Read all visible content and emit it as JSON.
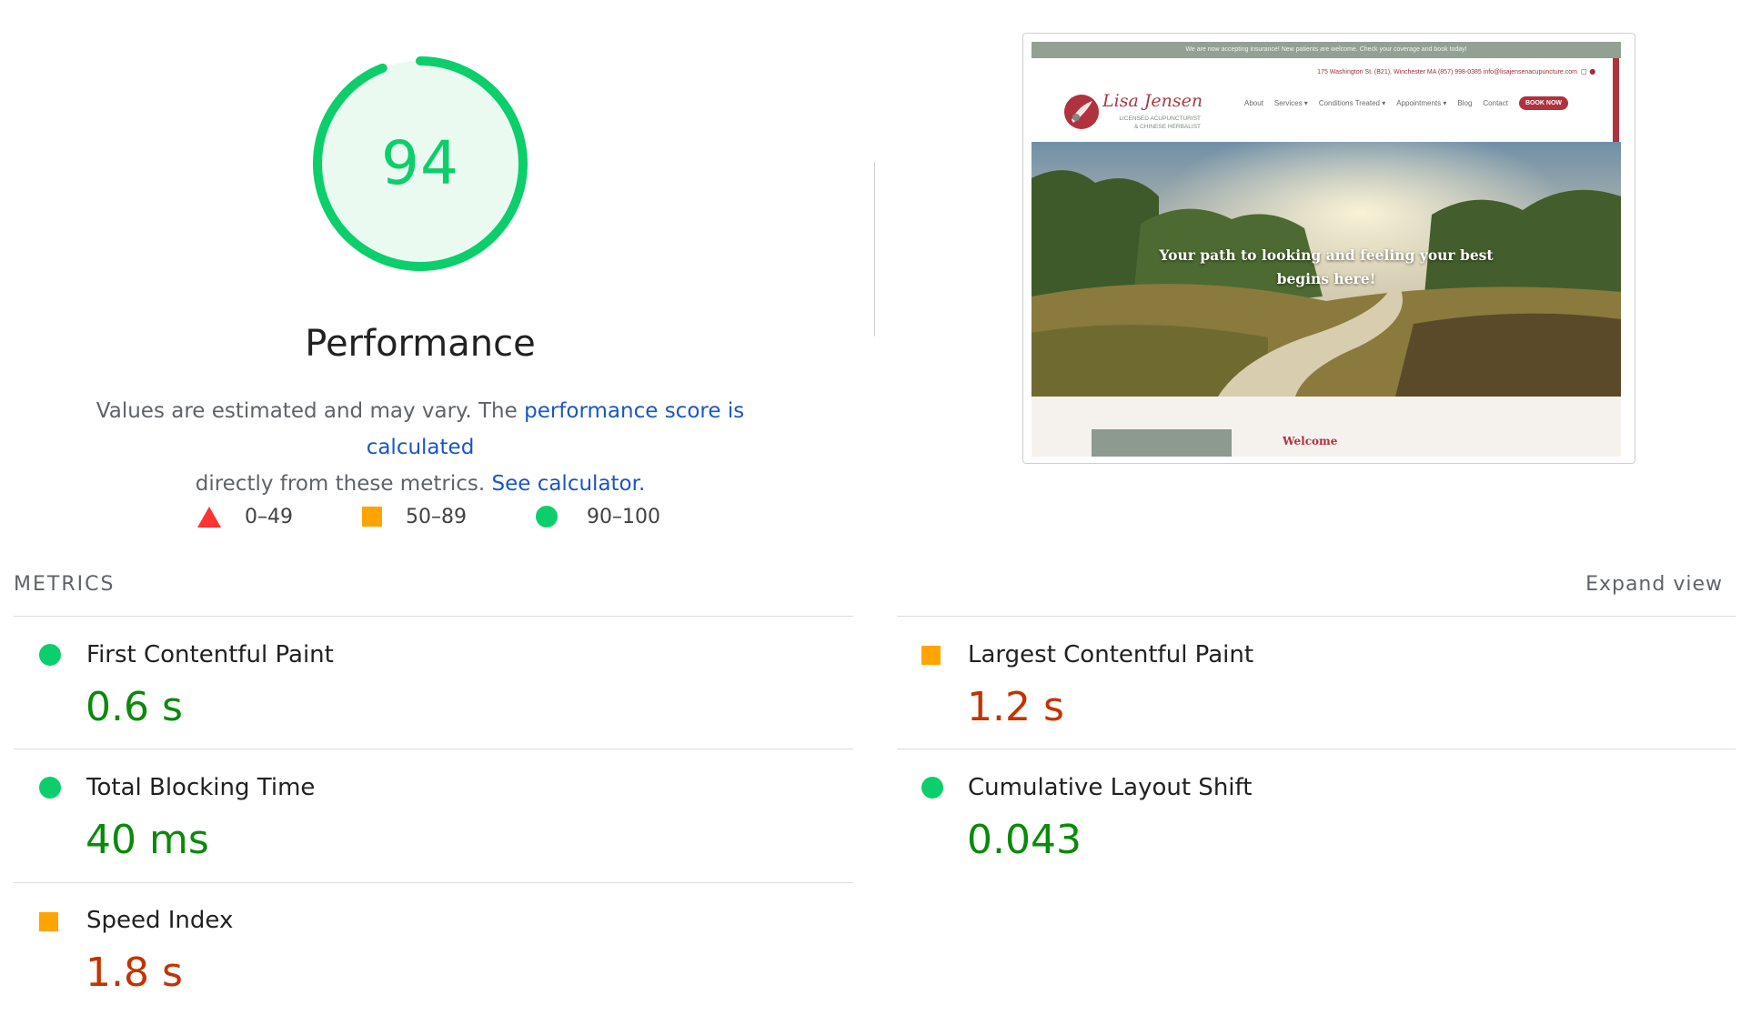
{
  "gauge": {
    "score": "94",
    "score_value": 94,
    "color": "#0cce6b",
    "title": "Performance"
  },
  "description": {
    "text1": "Values are estimated and may vary. The ",
    "link1": "performance score is calculated",
    "text2": "directly from these metrics.",
    "link2": "See calculator",
    "text3": "."
  },
  "legend": [
    {
      "shape": "triangle",
      "range": "0–49",
      "color": "#ff3333"
    },
    {
      "shape": "square",
      "range": "50–89",
      "color": "#ffa400"
    },
    {
      "shape": "circle",
      "range": "90–100",
      "color": "#0cce6b"
    }
  ],
  "screenshot": {
    "announcement": "We are now accepting insurance! New patients are welcome. Check your coverage and book today!",
    "contact_line": "175 Washington St. (B21), Winchester MA     (857) 998-0385     info@lisajensenacupuncture.com",
    "logo_name": "Lisa Jensen",
    "logo_sub1": "LICENSED ACUPUNCTURIST",
    "logo_sub2": "& CHINESE HERBALIST",
    "nav": [
      "About",
      "Services ▾",
      "Conditions Treated ▾",
      "Appointments ▾",
      "Blog",
      "Contact"
    ],
    "book_button": "BOOK NOW",
    "hero_line1": "Your path to looking and feeling your best",
    "hero_line2": "begins here!",
    "welcome": "Welcome"
  },
  "metrics": {
    "section_label": "METRICS",
    "expand_label": "Expand view",
    "items": [
      {
        "title": "First Contentful Paint",
        "value": "0.6 s",
        "status": "pass"
      },
      {
        "title": "Largest Contentful Paint",
        "value": "1.2 s",
        "status": "average"
      },
      {
        "title": "Total Blocking Time",
        "value": "40 ms",
        "status": "pass"
      },
      {
        "title": "Cumulative Layout Shift",
        "value": "0.043",
        "status": "pass"
      },
      {
        "title": "Speed Index",
        "value": "1.8 s",
        "status": "average"
      }
    ]
  },
  "colors": {
    "pass": "#0cce6b",
    "average": "#ffa400",
    "fail": "#ff3333",
    "pass_text": "#0a8a0a",
    "average_text": "#c33300",
    "link": "#1a56c4"
  }
}
